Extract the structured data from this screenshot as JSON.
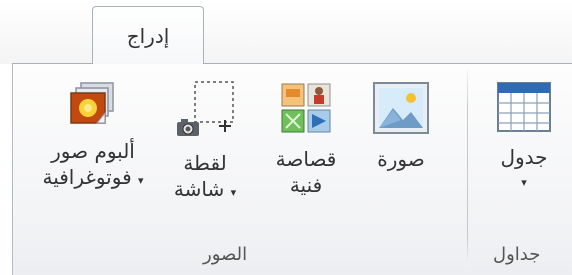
{
  "tabs": {
    "active": "إدراج"
  },
  "groups": {
    "pictures": {
      "label": "الصور",
      "buttons": {
        "album": {
          "line1": "ألبوم صور",
          "line2": "فوتوغرافية",
          "arrow": "▾"
        },
        "screenshot": {
          "line1": "لقطة",
          "line2": "شاشة",
          "arrow": "▾"
        },
        "clipart": {
          "line1": "قصاصة",
          "line2": "فنية"
        },
        "picture": {
          "line1": "صورة"
        }
      }
    },
    "tables": {
      "label": "جداول",
      "buttons": {
        "table": {
          "line1": "جدول",
          "arrow": "▾"
        }
      }
    }
  },
  "icons": {
    "album": "photo-album-icon",
    "screenshot": "screenshot-icon",
    "clipart": "clip-art-icon",
    "picture": "picture-icon",
    "table": "table-icon"
  }
}
